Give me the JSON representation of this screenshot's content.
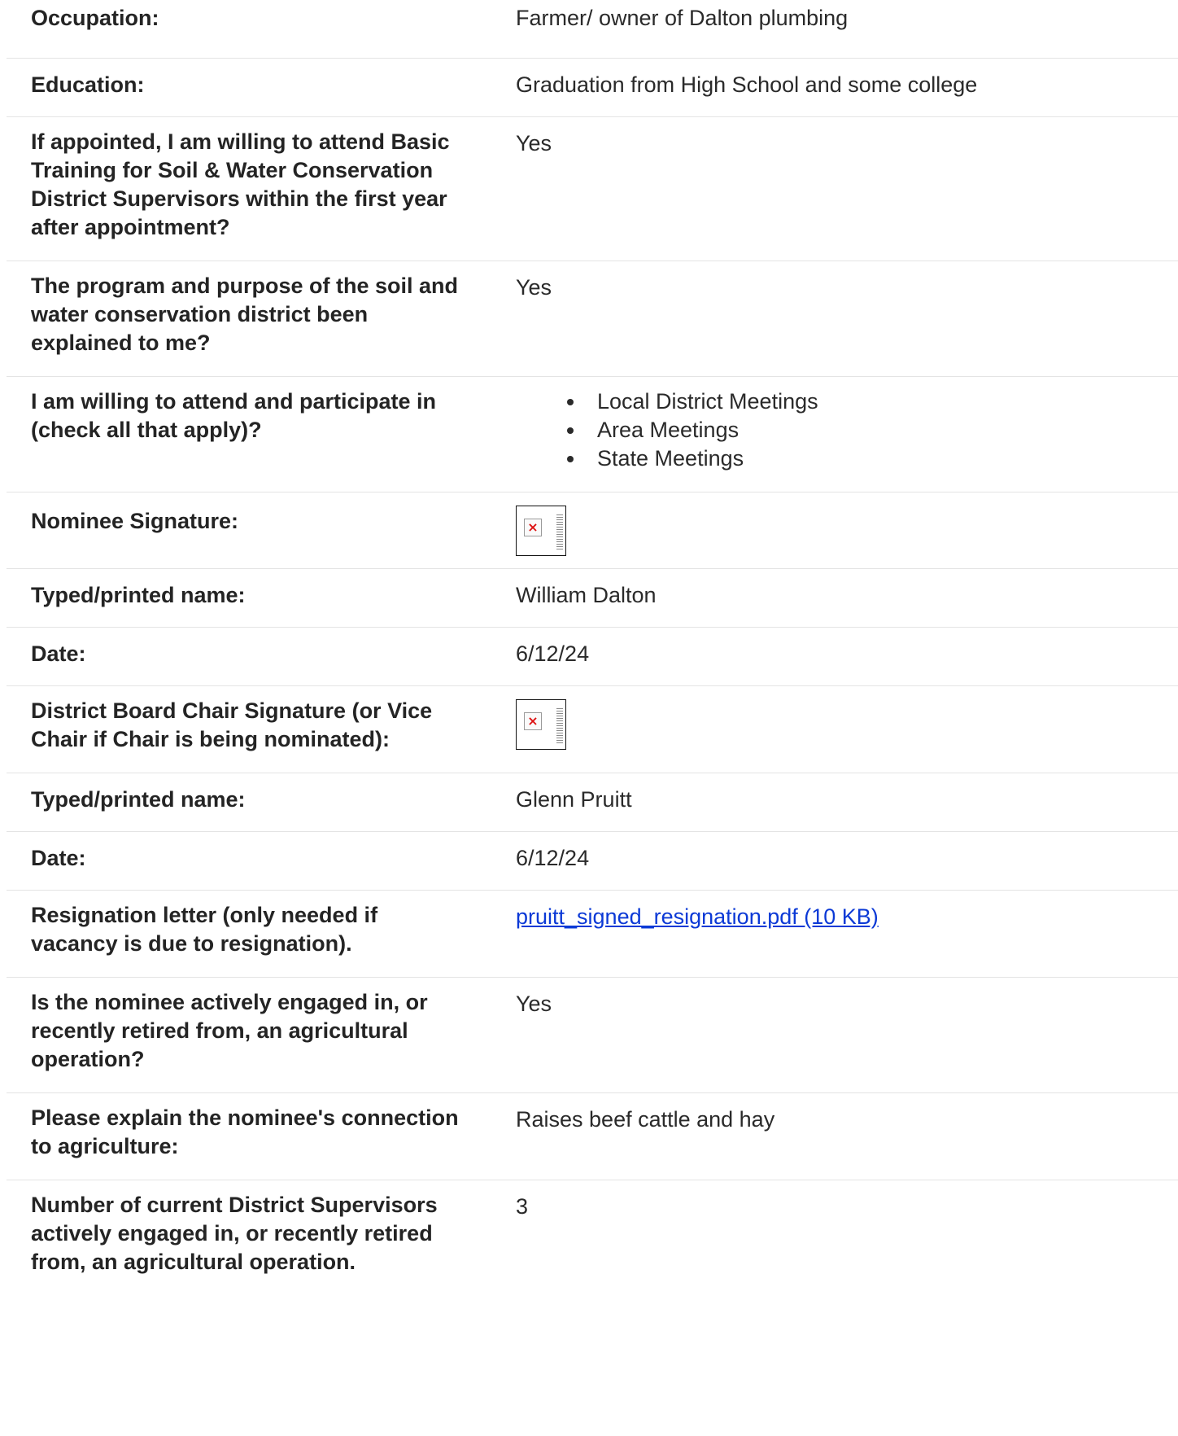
{
  "rows": [
    {
      "label": "Occupation:",
      "value": "Farmer/ owner of Dalton plumbing"
    },
    {
      "label": "Education:",
      "value": "Graduation from High School and some college"
    },
    {
      "label": "If appointed, I am willing to attend Basic Training for Soil & Water Conservation District Supervisors within the first year after appointment?",
      "value": "Yes"
    },
    {
      "label": "The program and purpose of the soil and water conservation district been explained to me?",
      "value": "Yes"
    },
    {
      "label": "I am willing to attend and participate in (check all that apply)?",
      "options": [
        "Local District Meetings",
        "Area Meetings",
        "State Meetings"
      ]
    },
    {
      "label": "Nominee Signature:",
      "signature_icon": "broken-image-icon"
    },
    {
      "label": "Typed/printed name:",
      "value": "William Dalton"
    },
    {
      "label": "Date:",
      "value": "6/12/24"
    },
    {
      "label": "District Board Chair Signature (or Vice Chair if Chair is being nominated):",
      "signature_icon": "broken-image-icon"
    },
    {
      "label": "Typed/printed name:",
      "value": "Glenn Pruitt"
    },
    {
      "label": "Date:",
      "value": "6/12/24"
    },
    {
      "label": "Resignation letter (only needed if vacancy is due to resignation).",
      "link_text": "pruitt_signed_resignation.pdf (10 KB)"
    },
    {
      "label": "Is the nominee actively engaged in, or recently retired from, an agricultural operation?",
      "value": "Yes"
    },
    {
      "label": "Please explain the nominee's connection to agriculture:",
      "value": "Raises beef cattle and hay"
    },
    {
      "label": "Number of current District Supervisors actively engaged in, or recently retired from, an agricultural operation.",
      "value": "3"
    }
  ],
  "colors": {
    "link": "#0b39d6",
    "divider": "#e4e4e4",
    "broken_image_x": "#dd1111"
  }
}
